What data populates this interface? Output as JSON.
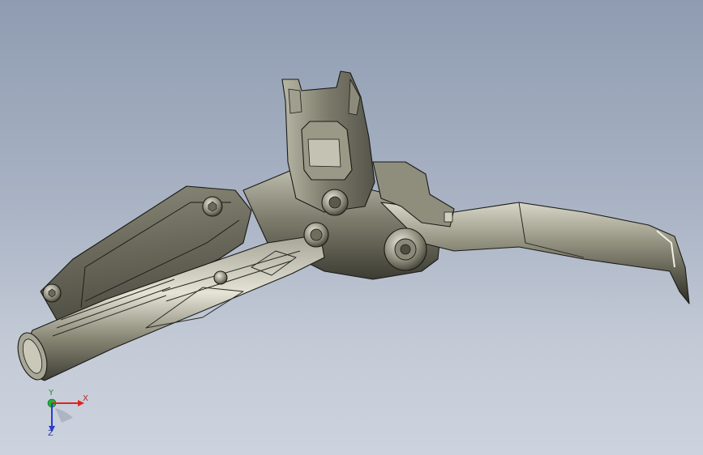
{
  "viewport": {
    "background_top": "#8f9cb1",
    "background_bottom": "#cdd3de"
  },
  "model": {
    "part_color": "#6d6d60",
    "edge_color": "#1a1a16"
  },
  "triad": {
    "x_label": "X",
    "y_label": "Y",
    "z_label": "Z",
    "x_color": "#e0231f",
    "y_color": "#1fb33a",
    "z_color": "#2a3ec8"
  }
}
